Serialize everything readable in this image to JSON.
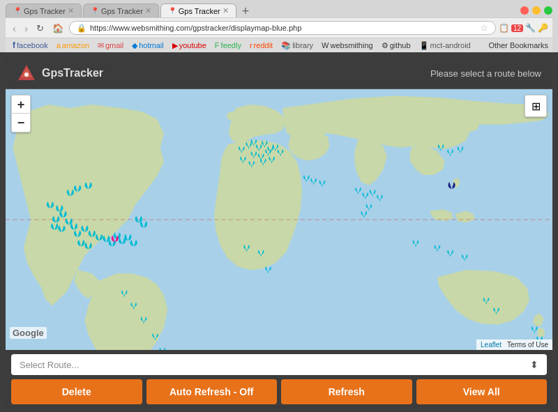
{
  "browser": {
    "tabs": [
      {
        "id": "tab1",
        "label": "Gps Tracker",
        "active": false,
        "favicon": "📍"
      },
      {
        "id": "tab2",
        "label": "Gps Tracker",
        "active": false,
        "favicon": "📍"
      },
      {
        "id": "tab3",
        "label": "Gps Tracker",
        "active": true,
        "favicon": "📍"
      }
    ],
    "address": "https://www.websmithing.com/gpstracker/displaymap-blue.php",
    "bookmarks": [
      {
        "label": "facebook",
        "icon": "f"
      },
      {
        "label": "amazon",
        "icon": "a"
      },
      {
        "label": "gmail",
        "icon": "M"
      },
      {
        "label": "hotmail",
        "icon": "h"
      },
      {
        "label": "youtube",
        "icon": "▶"
      },
      {
        "label": "feedly",
        "icon": "F"
      },
      {
        "label": "reddit",
        "icon": "r"
      },
      {
        "label": "library",
        "icon": "📚"
      },
      {
        "label": "websmithing",
        "icon": "W"
      },
      {
        "label": "github",
        "icon": "⚙"
      },
      {
        "label": "mct-android",
        "icon": "📱"
      }
    ],
    "other_bookmarks": "Other Bookmarks"
  },
  "app": {
    "title": "GpsTracker",
    "instruction": "Please select a route below",
    "logo_alt": "GpsTracker logo"
  },
  "map": {
    "zoom_in": "+",
    "zoom_out": "−",
    "layer_icon": "⊞",
    "leaflet_attr": "Leaflet",
    "terms_attr": "Terms of Use",
    "google_logo": "Google"
  },
  "controls": {
    "route_placeholder": "Select Route...",
    "buttons": [
      {
        "id": "delete",
        "label": "Delete"
      },
      {
        "id": "auto-refresh",
        "label": "Auto Refresh - Off"
      },
      {
        "id": "refresh",
        "label": "Refresh"
      },
      {
        "id": "view-all",
        "label": "View All"
      }
    ]
  }
}
